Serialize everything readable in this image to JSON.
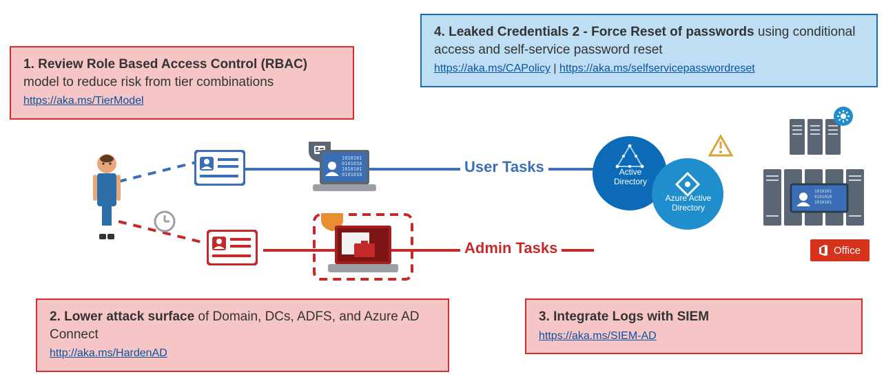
{
  "boxes": {
    "b1": {
      "title": "1. Review Role Based Access Control (RBAC)",
      "rest": " model to reduce risk from tier combinations",
      "link": "https://aka.ms/TierModel"
    },
    "b2": {
      "title": "2. Lower attack surface",
      "rest": " of Domain, DCs, ADFS, and Azure AD Connect",
      "link": "http://aka.ms/HardenAD"
    },
    "b3": {
      "title": "3. Integrate Logs with SIEM",
      "rest": "",
      "link": "https://aka.ms/SIEM-AD"
    },
    "b4": {
      "title": "4. Leaked Credentials 2 - Force Reset of passwords",
      "rest": " using conditional access and self-service password reset",
      "link1": "https://aka.ms/CAPolicy",
      "sep": "  |  ",
      "link2": "https://aka.ms/selfservicepasswordreset"
    }
  },
  "labels": {
    "user": "User Tasks",
    "admin": "Admin Tasks"
  },
  "icons": {
    "ad": "Active Directory",
    "aad": "Azure Active Directory",
    "office": "Office"
  },
  "colors": {
    "blue": "#3b6fb5",
    "red": "#c42a2a",
    "boxRedBg": "#f6c6c6",
    "boxBlueBg": "#bedff3",
    "adBlue": "#0d6ab6",
    "aadBlue": "#1e8ecd",
    "officeRed": "#d6321c",
    "orange": "#e88d32",
    "warn": "#d9a33a",
    "server": "#5a6673"
  }
}
